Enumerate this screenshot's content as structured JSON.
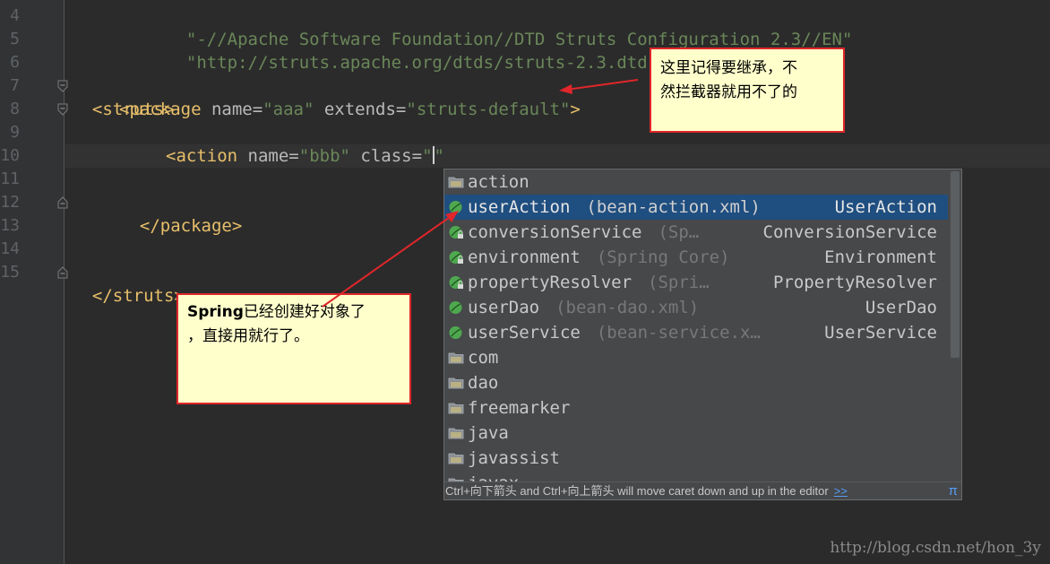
{
  "gutter": {
    "line_numbers": [
      "4",
      "5",
      "6",
      "7",
      "8",
      "9",
      "10",
      "11",
      "12",
      "13",
      "14",
      "15"
    ]
  },
  "code": {
    "line4": "\"-//Apache Software Foundation//DTD Struts Configuration 2.3//EN\"",
    "line5": "\"http://struts.apache.org/dtds/struts-2.3.dtd\">",
    "line7_tag": "<struts>",
    "line8_open": "<package",
    "line8_attr1": "name",
    "line8_eq1": "=",
    "line8_val1": "\"aaa\"",
    "line8_attr2": "extends",
    "line8_eq2": "=",
    "line8_val2": "\"struts-default\"",
    "line8_close": ">",
    "line10_open": "<action",
    "line10_attr1": "name",
    "line10_eq1": "=",
    "line10_val1": "\"bbb\"",
    "line10_attr2": "class",
    "line10_eq2": "=",
    "line10_quote_open": "\"",
    "line10_quote_close": "\"",
    "line12_tag": "</package>",
    "line15_tag": "</struts>"
  },
  "completion": {
    "items": [
      {
        "icon": "folder-icon",
        "name": "action",
        "hint": "",
        "type": ""
      },
      {
        "icon": "spring-bean-icon",
        "name": "userAction",
        "hint": "(bean-action.xml)",
        "type": "UserAction",
        "selected": true
      },
      {
        "icon": "spring-bean-locked-icon",
        "name": "conversionService",
        "hint": "(Sp…",
        "type": "ConversionService"
      },
      {
        "icon": "spring-bean-locked-icon",
        "name": "environment",
        "hint": "(Spring Core)",
        "type": "Environment"
      },
      {
        "icon": "spring-bean-locked-icon",
        "name": "propertyResolver",
        "hint": "(Spri…",
        "type": "PropertyResolver"
      },
      {
        "icon": "spring-bean-icon",
        "name": "userDao",
        "hint": "(bean-dao.xml)",
        "type": "UserDao"
      },
      {
        "icon": "spring-bean-icon",
        "name": "userService",
        "hint": "(bean-service.x…",
        "type": "UserService"
      },
      {
        "icon": "folder-icon",
        "name": "com",
        "hint": "",
        "type": ""
      },
      {
        "icon": "folder-icon",
        "name": "dao",
        "hint": "",
        "type": ""
      },
      {
        "icon": "folder-icon",
        "name": "freemarker",
        "hint": "",
        "type": ""
      },
      {
        "icon": "folder-icon",
        "name": "java",
        "hint": "",
        "type": ""
      },
      {
        "icon": "folder-icon",
        "name": "javassist",
        "hint": "",
        "type": ""
      },
      {
        "icon": "folder-icon",
        "name": "javax",
        "hint": "",
        "type": ""
      }
    ],
    "footer_text": "Ctrl+向下箭头 and Ctrl+向上箭头 will move caret down and up in the editor",
    "footer_link": ">>",
    "footer_pi": "π"
  },
  "notes": {
    "note1": "这里记得要继承，不\n然拦截器就用不了的",
    "note2_bold": "Spring",
    "note2_rest": "已经创建好对象了\n，直接用就行了。"
  },
  "watermark": "http://blog.csdn.net/hon_3y",
  "colors": {
    "background": "#2b2b2b",
    "tag": "#e8bf6a",
    "string": "#6a8759",
    "selection": "#1f4e80",
    "note_bg": "#ffffcc",
    "note_border": "#e0262a"
  }
}
